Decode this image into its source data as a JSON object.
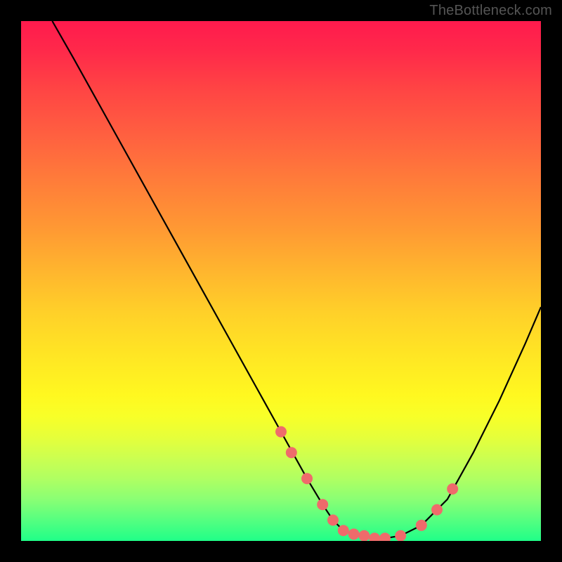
{
  "watermark": "TheBottleneck.com",
  "chart_data": {
    "type": "line",
    "title": "",
    "xlabel": "",
    "ylabel": "",
    "xlim": [
      0,
      100
    ],
    "ylim": [
      0,
      100
    ],
    "series": [
      {
        "name": "bottleneck-curve",
        "x": [
          6,
          10,
          15,
          20,
          25,
          30,
          35,
          40,
          45,
          50,
          55,
          58,
          60,
          62,
          65,
          68,
          70,
          73,
          77,
          82,
          87,
          92,
          97,
          100
        ],
        "y": [
          100,
          93,
          84,
          75,
          66,
          57,
          48,
          39,
          30,
          21,
          12,
          7,
          4,
          2,
          1,
          0.5,
          0.5,
          1,
          3,
          8,
          17,
          27,
          38,
          45
        ]
      }
    ],
    "markers": {
      "name": "highlight-points",
      "x": [
        50,
        52,
        55,
        58,
        60,
        62,
        64,
        66,
        68,
        70,
        73,
        77,
        80,
        83
      ],
      "y": [
        21,
        17,
        12,
        7,
        4,
        2,
        1.3,
        1,
        0.5,
        0.5,
        1,
        3,
        6,
        10
      ]
    },
    "gradient_stops": [
      {
        "pos": 0,
        "color": "#ff1a4d"
      },
      {
        "pos": 50,
        "color": "#ffdc28"
      },
      {
        "pos": 100,
        "color": "#20ff88"
      }
    ]
  }
}
